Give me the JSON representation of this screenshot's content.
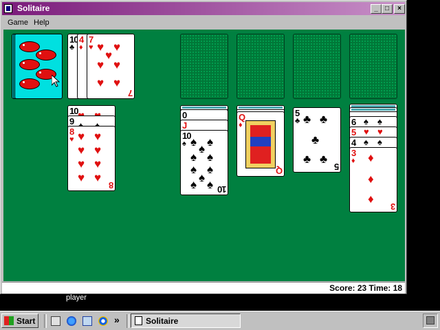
{
  "window": {
    "title": "Solitaire",
    "minimize": "_",
    "maximize": "□",
    "close": "×"
  },
  "menu": {
    "game": "Game",
    "help": "Help"
  },
  "status": {
    "text": "Score: 23 Time: 18"
  },
  "waste": {
    "cards": [
      {
        "rank": "10",
        "suit": "♣",
        "color": "black"
      },
      {
        "rank": "4",
        "suit": "♦",
        "color": "red"
      },
      {
        "rank": "7",
        "suit": "♥",
        "color": "red"
      }
    ]
  },
  "tableau": {
    "col1": {
      "cards": [
        "10",
        "9",
        "8"
      ],
      "suits": [
        "♥",
        "♠",
        "♥"
      ]
    },
    "col4": {
      "cards": [
        "10"
      ],
      "hidden": [
        "0",
        "J"
      ],
      "suits": [
        "♠"
      ]
    },
    "col5": {
      "cards": [
        "Q"
      ],
      "suits": [
        "♦"
      ]
    },
    "col6": {
      "cards": [
        "5"
      ],
      "suits": [
        "♣"
      ]
    },
    "col7": {
      "cards": [
        "6",
        "5",
        "4",
        "3"
      ],
      "suits": [
        "♠",
        "♥",
        "♠",
        "♦"
      ]
    }
  },
  "desktop": {
    "label": "player"
  },
  "taskbar": {
    "start": "Start",
    "chevron": "»",
    "task": "Solitaire"
  },
  "colors": {
    "felt": "#008040",
    "title_start": "#7a1a7a",
    "title_end": "#c890c8",
    "card_red": "#e01010"
  }
}
